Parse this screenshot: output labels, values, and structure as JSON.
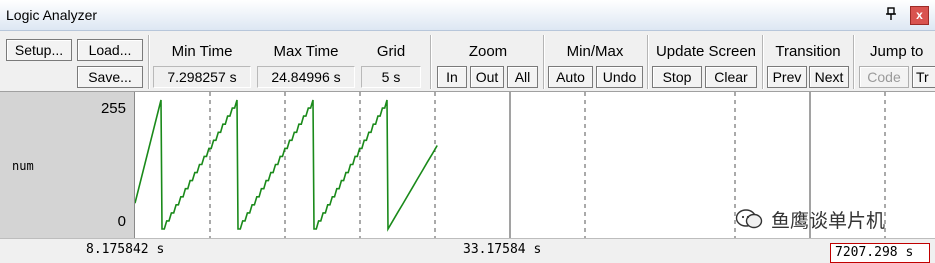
{
  "window": {
    "title": "Logic Analyzer",
    "pin_glyph": "📌",
    "close_glyph": "x"
  },
  "toolbar": {
    "setup_label": "Setup...",
    "load_label": "Load...",
    "save_label": "Save...",
    "min_time": {
      "header": "Min Time",
      "value": "7.298257 s"
    },
    "max_time": {
      "header": "Max Time",
      "value": "24.84996 s"
    },
    "grid": {
      "header": "Grid",
      "value": "5 s"
    },
    "zoom": {
      "header": "Zoom",
      "in": "In",
      "out": "Out",
      "all": "All"
    },
    "minmax": {
      "header": "Min/Max",
      "auto": "Auto",
      "undo": "Undo"
    },
    "update_screen": {
      "header": "Update Screen",
      "stop": "Stop",
      "clear": "Clear"
    },
    "transition": {
      "header": "Transition",
      "prev": "Prev",
      "next": "Next"
    },
    "jump_to": {
      "header": "Jump to",
      "code": "Code",
      "trace": "Tr"
    }
  },
  "signal": {
    "name": "num",
    "max_label": "255",
    "min_label": "0"
  },
  "status": {
    "left_time": "8.175842 s",
    "center_time": "33.17584 s",
    "cursor_time": "7207.298 s"
  },
  "watermark": {
    "text": "鱼鹰谈单片机"
  },
  "colors": {
    "waveform": "#1a8a1a",
    "close_button": "#d9534f",
    "cursor_box": "#c00000"
  },
  "chart_data": {
    "type": "line",
    "series": [
      {
        "values_description_free": true,
        "pattern": "sawtooth",
        "min": 0,
        "max": 255,
        "ramp_count": 4,
        "final_partial_max": 165
      }
    ]
  }
}
